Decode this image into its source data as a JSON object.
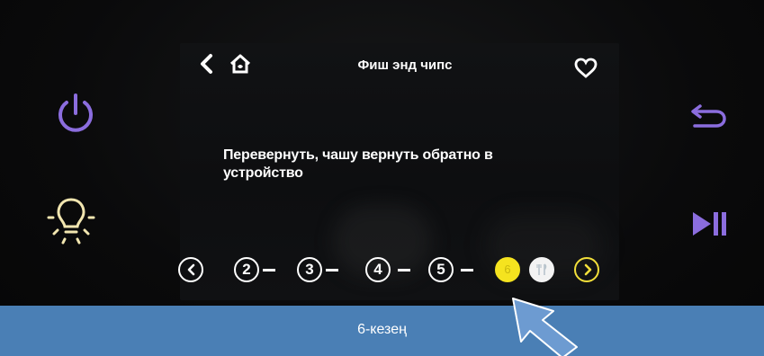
{
  "screen": {
    "title": "Фиш энд чипс",
    "instruction": "Перевернуть, чашу вернуть обратно в устройство"
  },
  "stepper": {
    "steps": [
      "2",
      "3",
      "4",
      "5",
      "6"
    ],
    "current_step": "6",
    "accent_color": "#f5e31f"
  },
  "banner": {
    "label": "6-кезең",
    "color": "#4a7fb5"
  },
  "icons": {
    "back": "chevron-left-icon",
    "home": "home-icon",
    "favorite": "heart-icon",
    "power": "power-icon",
    "light": "light-bulb-icon",
    "undo": "undo-icon",
    "play_pause": "play-pause-icon"
  },
  "colors": {
    "power_accent": "#8b6dde",
    "light_accent": "#f2e6b0"
  }
}
